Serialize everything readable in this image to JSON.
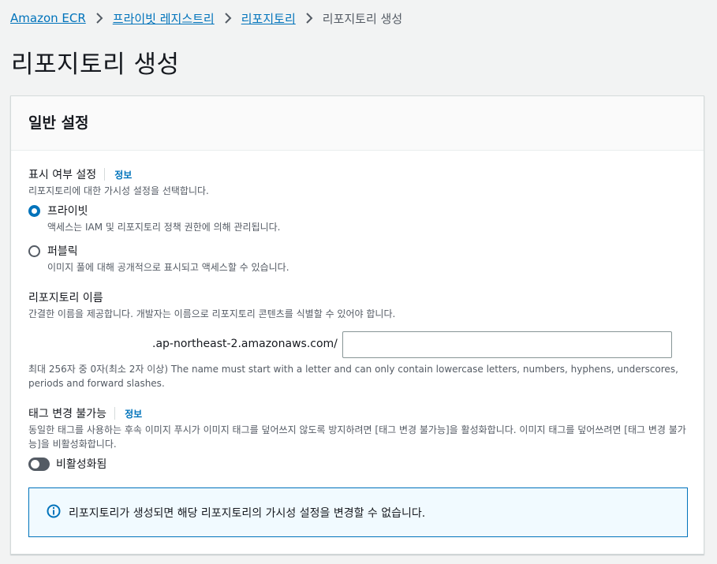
{
  "breadcrumb": {
    "items": [
      "Amazon ECR",
      "프라이빗 레지스트리",
      "리포지토리"
    ],
    "current": "리포지토리 생성"
  },
  "page": {
    "title": "리포지토리 생성"
  },
  "general_settings": {
    "title": "일반 설정",
    "visibility": {
      "label": "표시 여부 설정",
      "info": "정보",
      "description": "리포지토리에 대한 가시성 설정을 선택합니다.",
      "options": [
        {
          "label": "프라이빗",
          "description": "액세스는 IAM 및 리포지토리 정책 권한에 의해 관리됩니다.",
          "selected": true
        },
        {
          "label": "퍼블릭",
          "description": "이미지 풀에 대해 공개적으로 표시되고 액세스할 수 있습니다.",
          "selected": false
        }
      ]
    },
    "repo_name": {
      "label": "리포지토리 이름",
      "description": "간결한 이름을 제공합니다. 개발자는 이름으로 리포지토리 콘텐츠를 식별할 수 있어야 합니다.",
      "prefix": ".ap-northeast-2.amazonaws.com/",
      "value": "",
      "constraint": "최대 256자 중 0자(최소 2자 이상) The name must start with a letter and can only contain lowercase letters, numbers, hyphens, underscores, periods and forward slashes."
    },
    "tag_immutability": {
      "label": "태그 변경 불가능",
      "info": "정보",
      "description": "동일한 태그를 사용하는 후속 이미지 푸시가 이미지 태그를 덮어쓰지 않도록 방지하려면 [태그 변경 불가능]을 활성화합니다. 이미지 태그를 덮어쓰려면 [태그 변경 불가능]을 비활성화합니다.",
      "toggle_label": "비활성화됨",
      "enabled": false
    },
    "alert": {
      "icon": "info-icon",
      "text": "리포지토리가 생성되면 해당 리포지토리의 가시성 설정을 변경할 수 없습니다."
    }
  }
}
